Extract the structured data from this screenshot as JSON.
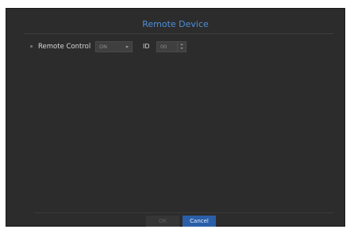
{
  "dialog": {
    "title": "Remote Device"
  },
  "remote_control": {
    "label": "Remote Control",
    "value": "ON",
    "id_label": "ID",
    "id_value": "00"
  },
  "buttons": {
    "ok": "OK",
    "cancel": "Cancel"
  },
  "colors": {
    "background": "#2c2c2c",
    "title": "#4c8fd8",
    "primary_button": "#2a5fa8"
  }
}
